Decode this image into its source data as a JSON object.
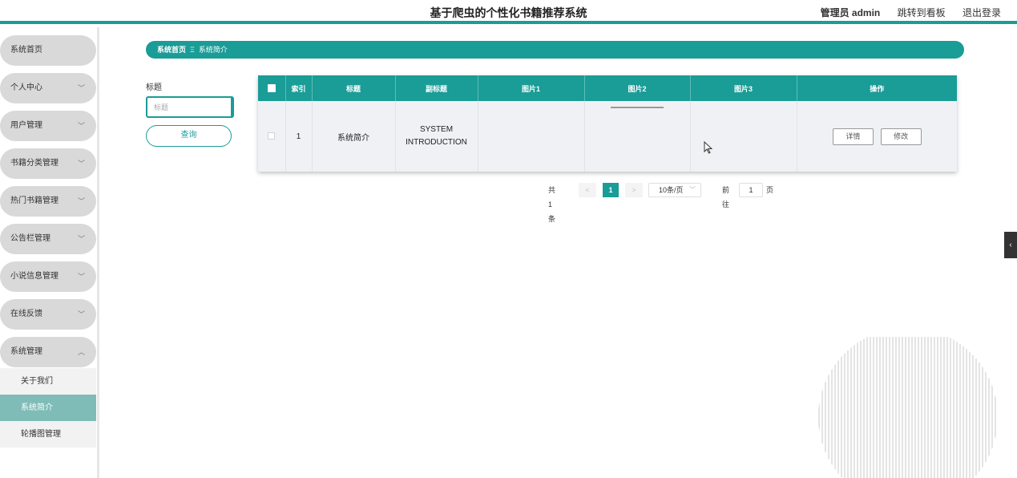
{
  "header": {
    "title": "基于爬虫的个性化书籍推荐系统",
    "admin": "管理员 admin",
    "board_link": "跳转到看板",
    "logout": "退出登录"
  },
  "sidebar": {
    "items": [
      {
        "label": "系统首页"
      },
      {
        "label": "个人中心"
      },
      {
        "label": "用户管理"
      },
      {
        "label": "书籍分类管理"
      },
      {
        "label": "热门书籍管理"
      },
      {
        "label": "公告栏管理"
      },
      {
        "label": "小说信息管理"
      },
      {
        "label": "在线反馈"
      },
      {
        "label": "系统管理"
      }
    ],
    "subitems": [
      {
        "label": "关于我们"
      },
      {
        "label": "系统简介"
      },
      {
        "label": "轮播图管理"
      }
    ]
  },
  "breadcrumb": {
    "home": "系统首页",
    "separator": "Ξ",
    "current": "系统简介"
  },
  "search": {
    "label": "标题",
    "placeholder": "标题",
    "button": "查询"
  },
  "table": {
    "headers": [
      "索引",
      "标题",
      "副标题",
      "图片1",
      "图片2",
      "图片3",
      "操作"
    ],
    "rows": [
      {
        "index": "1",
        "title": "系统简介",
        "subtitle": "SYSTEM INTRODUCTION",
        "detail": "详情",
        "edit": "修改"
      }
    ]
  },
  "pagination": {
    "total": "共 1 条",
    "prev": "<",
    "page": "1",
    "next": ">",
    "page_size": "10条/页",
    "goto": "前往",
    "goto_value": "1",
    "page_unit": "页"
  },
  "colors": {
    "accent": "#1a9c97"
  }
}
